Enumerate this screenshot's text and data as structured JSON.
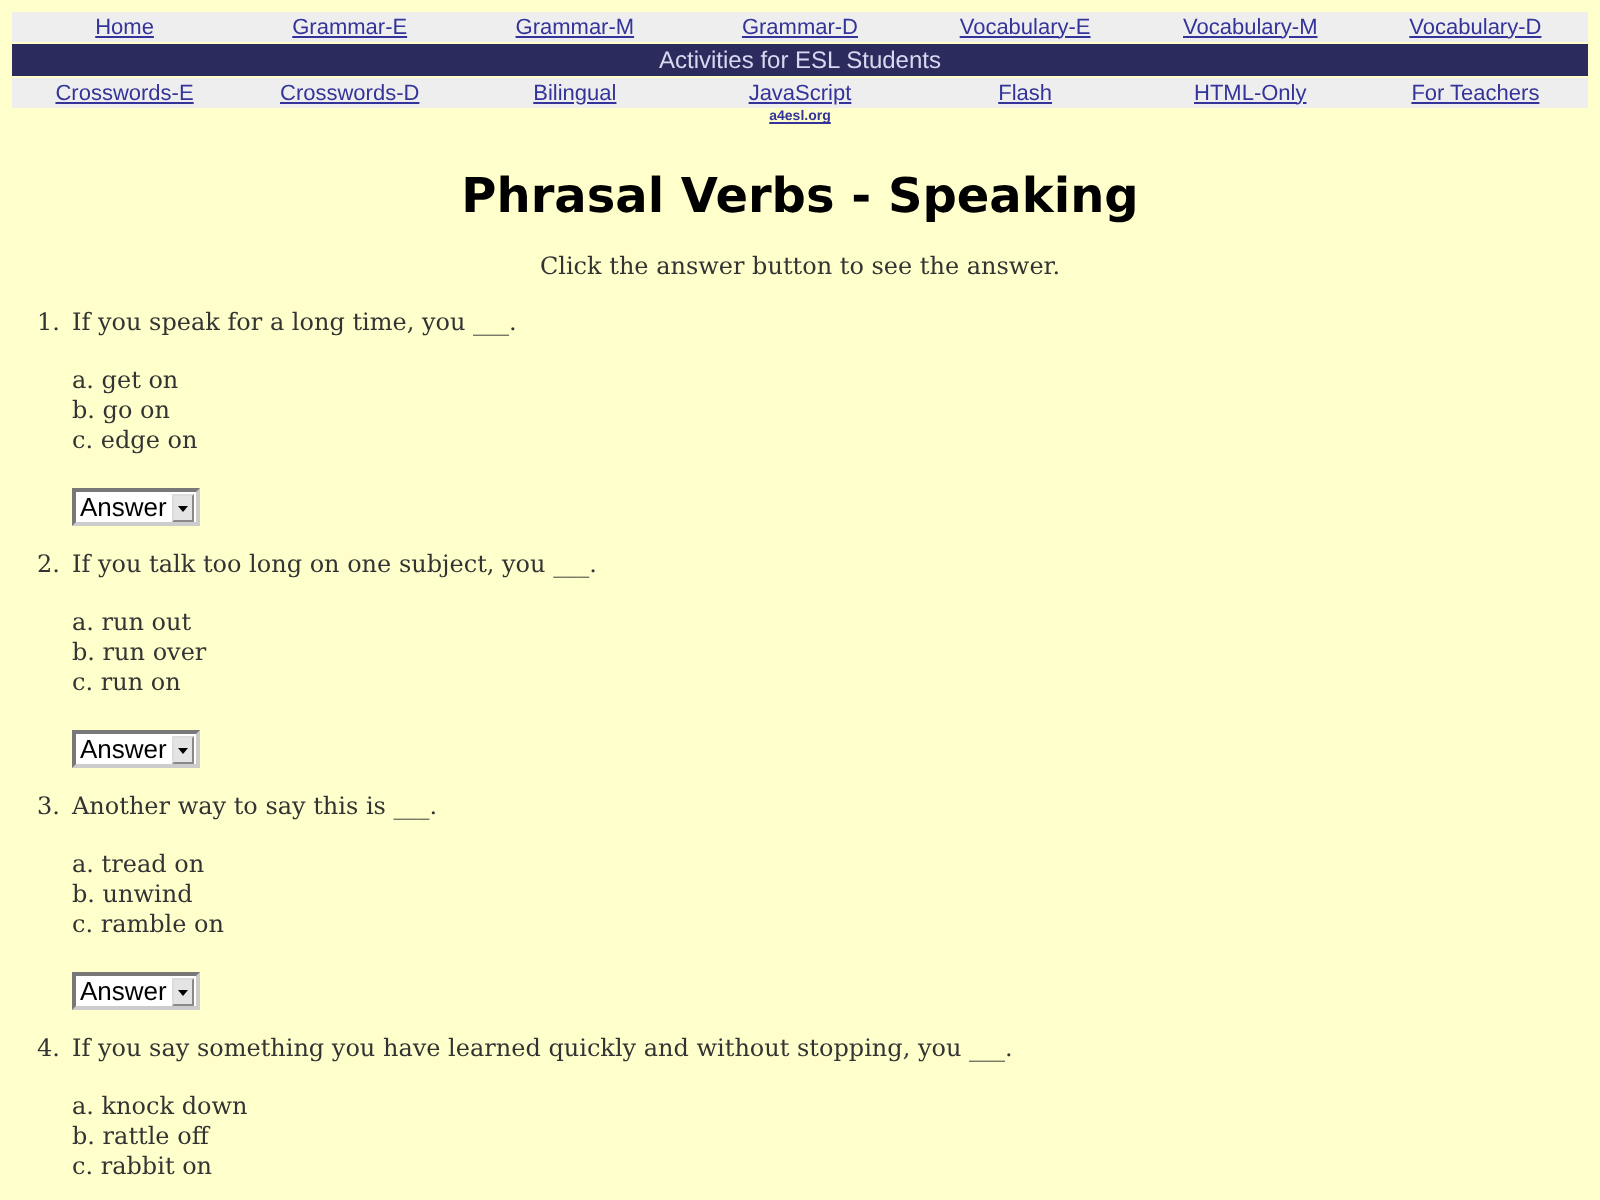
{
  "nav_top": [
    "Home",
    "Grammar-E",
    "Grammar-M",
    "Grammar-D",
    "Vocabulary-E",
    "Vocabulary-M",
    "Vocabulary-D"
  ],
  "banner": "Activities for ESL Students",
  "nav_bottom": [
    "Crosswords-E",
    "Crosswords-D",
    "Bilingual",
    "JavaScript",
    "Flash",
    "HTML-Only",
    "For Teachers"
  ],
  "site_link": "a4esl.org",
  "title": "Phrasal Verbs - Speaking",
  "instruction": "Click the answer button to see the answer.",
  "questions": [
    {
      "number": "1.",
      "text": "If you speak for a long time, you ___.",
      "options": [
        "a. get on",
        "b. go on",
        "c. edge on"
      ],
      "answer_label": "Answer"
    },
    {
      "number": "2.",
      "text": "If you talk too long on one subject, you ___.",
      "options": [
        "a. run out",
        "b. run over",
        "c. run on"
      ],
      "answer_label": "Answer"
    },
    {
      "number": "3.",
      "text": "Another way to say this is ___.",
      "options": [
        "a. tread on",
        "b. unwind",
        "c. ramble on"
      ],
      "answer_label": "Answer"
    },
    {
      "number": "4.",
      "text": "If you say something you have learned quickly and without stopping, you ___.",
      "options": [
        "a. knock down",
        "b. rattle off",
        "c. rabbit on"
      ]
    }
  ]
}
